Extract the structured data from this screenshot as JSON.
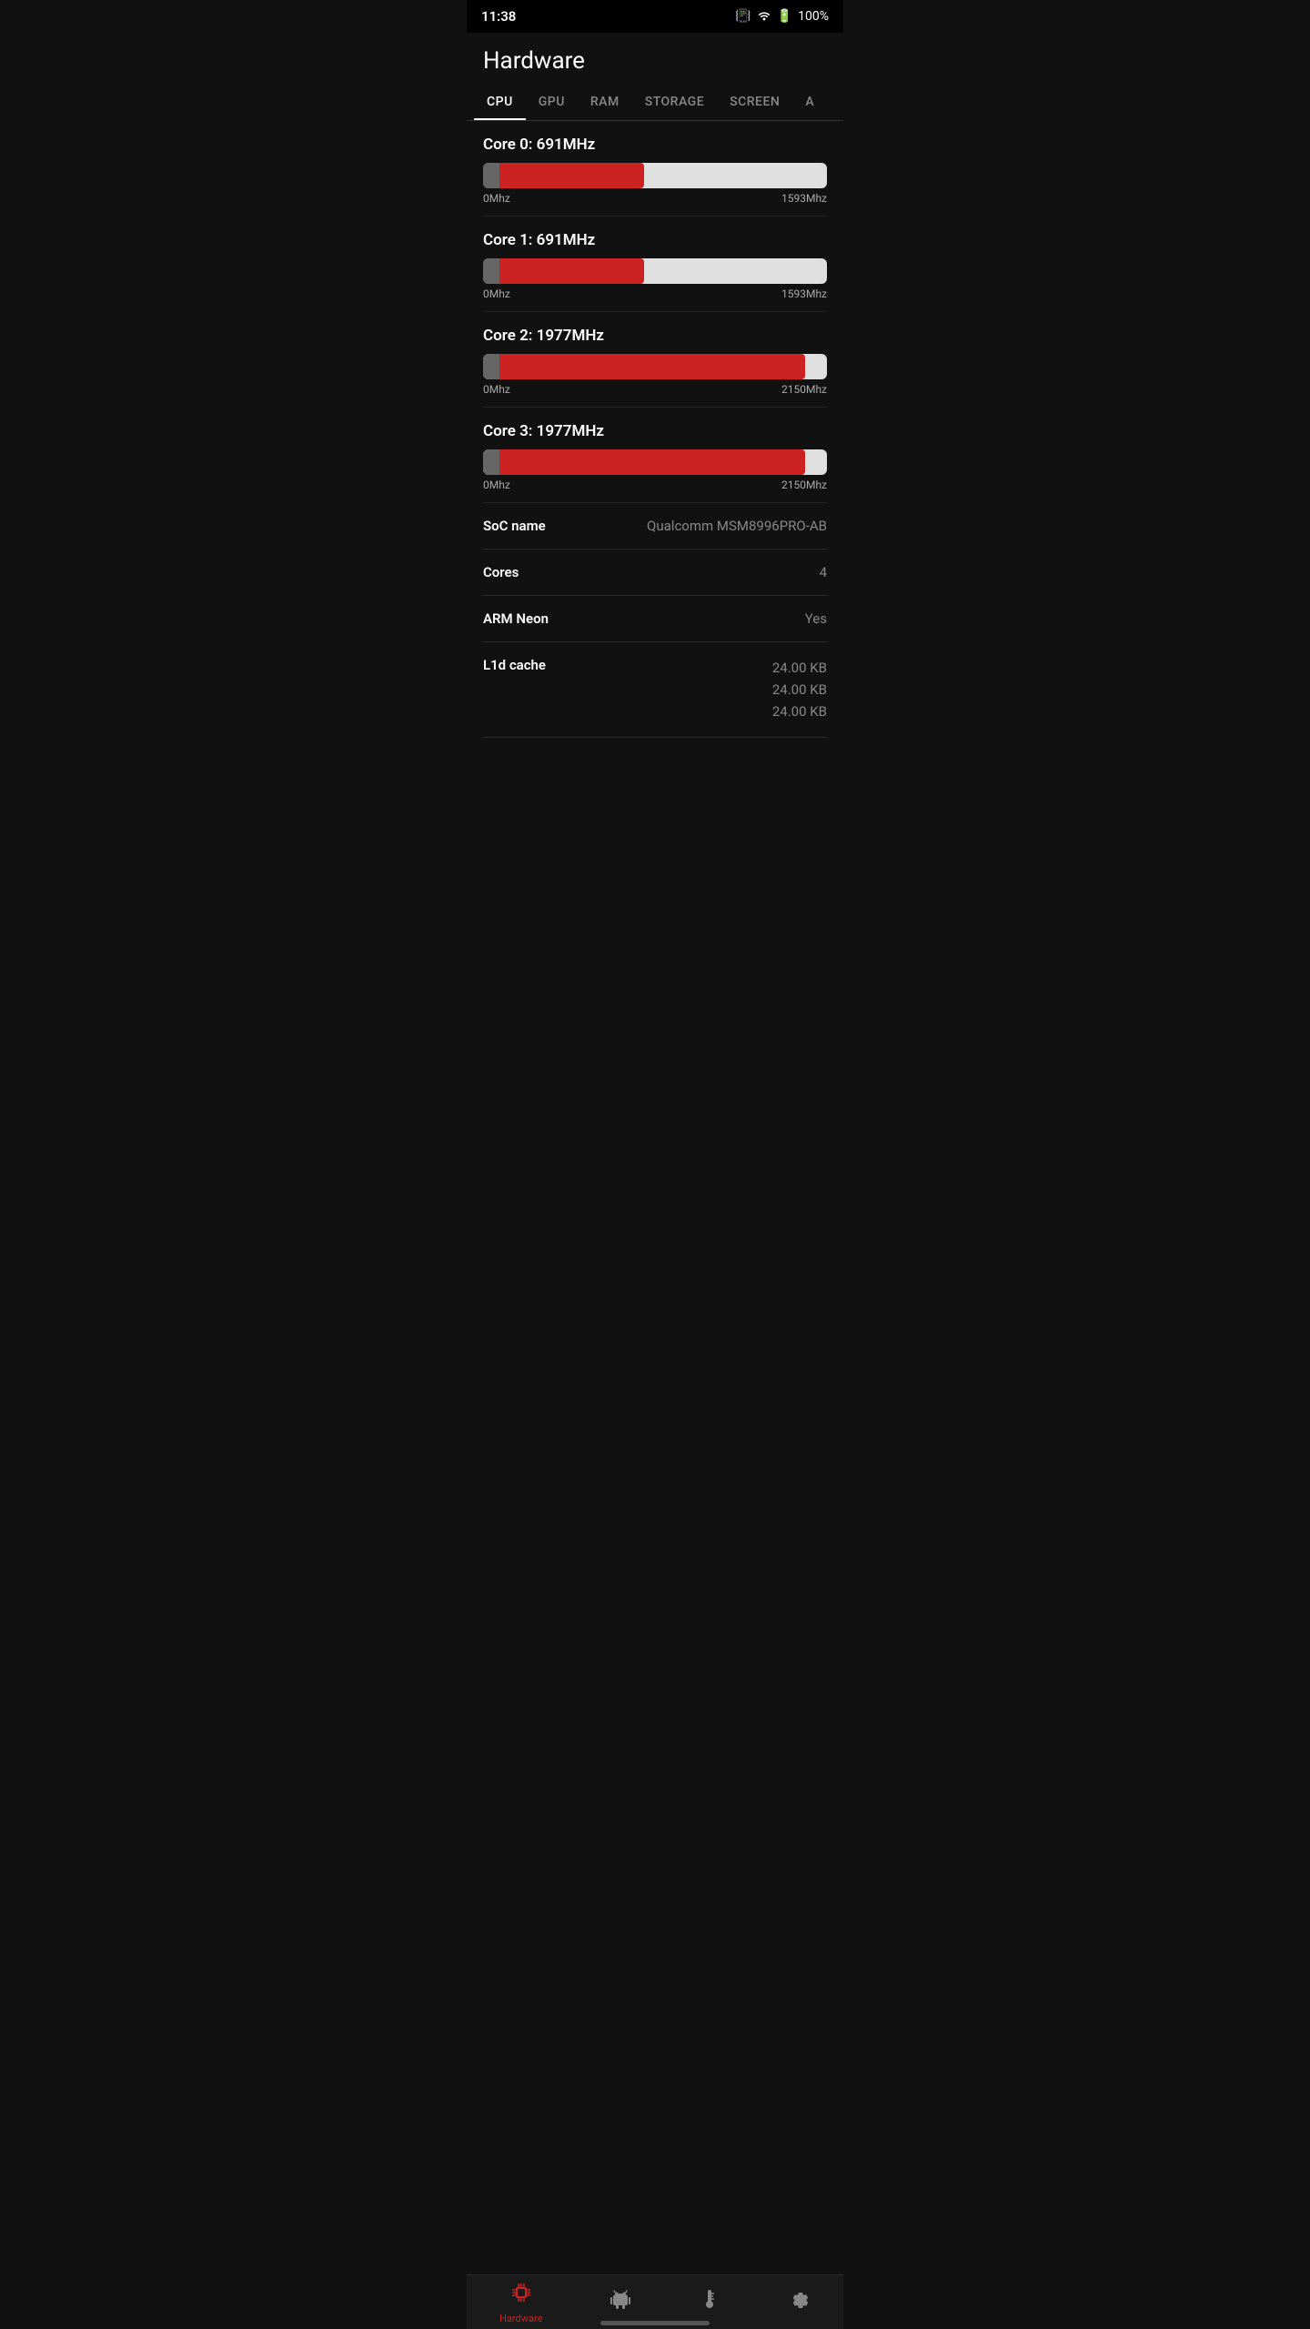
{
  "statusBar": {
    "time": "11:38",
    "battery": "100%",
    "batteryIcon": "🔋",
    "wifiIcon": "▼",
    "vibrateIcon": "📳"
  },
  "header": {
    "title": "Hardware"
  },
  "tabs": [
    {
      "id": "cpu",
      "label": "CPU",
      "active": true
    },
    {
      "id": "gpu",
      "label": "GPU",
      "active": false
    },
    {
      "id": "ram",
      "label": "RAM",
      "active": false
    },
    {
      "id": "storage",
      "label": "STORAGE",
      "active": false
    },
    {
      "id": "screen",
      "label": "SCREEN",
      "active": false
    },
    {
      "id": "a",
      "label": "A",
      "active": false
    }
  ],
  "cores": [
    {
      "id": "core0",
      "title": "Core 0: 691MHz",
      "freq": 691,
      "maxFreq": 1593,
      "fillPercent": 43,
      "minLabel": "0Mhz",
      "maxLabel": "1593Mhz"
    },
    {
      "id": "core1",
      "title": "Core 1: 691MHz",
      "freq": 691,
      "maxFreq": 1593,
      "fillPercent": 43,
      "minLabel": "0Mhz",
      "maxLabel": "1593Mhz"
    },
    {
      "id": "core2",
      "title": "Core 2: 1977MHz",
      "freq": 1977,
      "maxFreq": 2150,
      "fillPercent": 90,
      "minLabel": "0Mhz",
      "maxLabel": "2150Mhz"
    },
    {
      "id": "core3",
      "title": "Core 3: 1977MHz",
      "freq": 1977,
      "maxFreq": 2150,
      "fillPercent": 90,
      "minLabel": "0Mhz",
      "maxLabel": "2150Mhz"
    }
  ],
  "infoRows": [
    {
      "id": "soc-name",
      "label": "SoC name",
      "value": "Qualcomm MSM8996PRO-AB",
      "multiline": false
    },
    {
      "id": "cores",
      "label": "Cores",
      "value": "4",
      "multiline": false
    },
    {
      "id": "arm-neon",
      "label": "ARM Neon",
      "value": "Yes",
      "multiline": false
    },
    {
      "id": "l1d-cache",
      "label": "L1d cache",
      "value": "24.00 KB\n24.00 KB\n24.00 KB",
      "multiline": true
    }
  ],
  "bottomNav": [
    {
      "id": "hardware",
      "label": "Hardware",
      "icon": "chip",
      "active": true
    },
    {
      "id": "android",
      "label": "",
      "icon": "android",
      "active": false
    },
    {
      "id": "temp",
      "label": "",
      "icon": "temp",
      "active": false
    },
    {
      "id": "settings",
      "label": "",
      "icon": "settings",
      "active": false
    }
  ],
  "colors": {
    "accent": "#cc2222",
    "background": "#111111",
    "barFill": "#cc2222",
    "barThumb": "#666666",
    "barBg": "#e0e0e0",
    "textPrimary": "#ffffff",
    "textSecondary": "#888888",
    "divider": "#2a2a2a"
  }
}
